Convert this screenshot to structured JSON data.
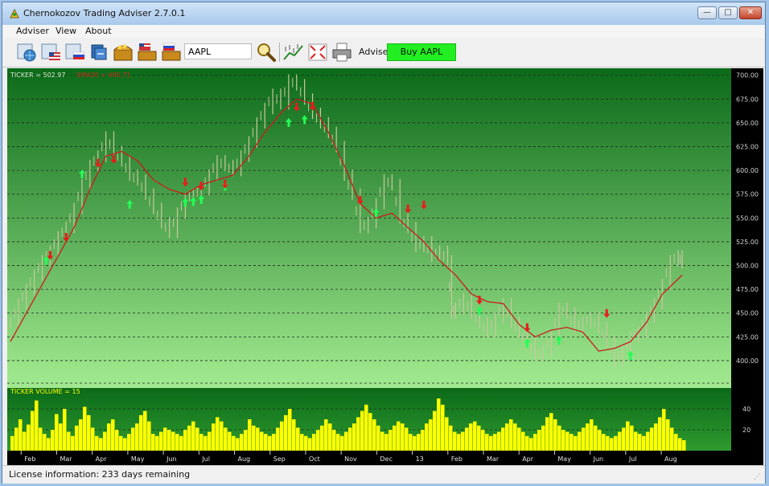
{
  "window": {
    "title": "Chernokozov Trading Adviser 2.7.0.1"
  },
  "menu": [
    "Adviser",
    "View",
    "About"
  ],
  "toolbar": {
    "icons": [
      "open-globe-icon",
      "chart-us-flag-icon",
      "chart-ru-flag-icon",
      "stack-icon",
      "treasure-chest-icon",
      "treasure-chest-us-icon",
      "treasure-chest-ru-icon"
    ],
    "ticker_value": "AAPL",
    "advise_label": "Advise:",
    "advise_value": "Buy AAPL",
    "colors": {
      "advise_bg": "#22ee22"
    }
  },
  "status": {
    "text": "License information: 233 days remaining"
  },
  "chart_data": [
    {
      "type": "line",
      "name": "price-chart",
      "legend": [
        "TICKER = 502.97",
        "SMA20 = 490.71"
      ],
      "colors": {
        "bg_top": "#0d6b1a",
        "bg_bottom": "#9ee68a",
        "price": "#c9c9a0",
        "sma": "#cc1b1b",
        "grid": "#333333"
      },
      "yticks": [
        700,
        675,
        650,
        625,
        600,
        575,
        550,
        525,
        500,
        475,
        450,
        425,
        400
      ],
      "ylim": [
        378,
        704
      ],
      "grid": true,
      "x_months": [
        "Feb",
        "Mar",
        "Apr",
        "May",
        "Jun",
        "Jul",
        "Aug",
        "Sep",
        "Oct",
        "Nov",
        "Dec",
        "13",
        "Feb",
        "Mar",
        "Apr",
        "May",
        "Jun",
        "Jul",
        "Aug"
      ],
      "price_points": [
        [
          0,
          440
        ],
        [
          2,
          460
        ],
        [
          4,
          475
        ],
        [
          6,
          490
        ],
        [
          8,
          505
        ],
        [
          10,
          515
        ],
        [
          12,
          530
        ],
        [
          14,
          540
        ],
        [
          16,
          560
        ],
        [
          18,
          585
        ],
        [
          20,
          605
        ],
        [
          22,
          615
        ],
        [
          24,
          635
        ],
        [
          26,
          620
        ],
        [
          28,
          610
        ],
        [
          30,
          595
        ],
        [
          32,
          590
        ],
        [
          34,
          575
        ],
        [
          36,
          560
        ],
        [
          38,
          545
        ],
        [
          40,
          535
        ],
        [
          42,
          555
        ],
        [
          44,
          570
        ],
        [
          46,
          575
        ],
        [
          48,
          580
        ],
        [
          50,
          595
        ],
        [
          52,
          610
        ],
        [
          54,
          605
        ],
        [
          56,
          600
        ],
        [
          58,
          615
        ],
        [
          60,
          630
        ],
        [
          62,
          650
        ],
        [
          64,
          665
        ],
        [
          66,
          680
        ],
        [
          68,
          670
        ],
        [
          70,
          695
        ],
        [
          72,
          690
        ],
        [
          74,
          675
        ],
        [
          76,
          660
        ],
        [
          78,
          650
        ],
        [
          80,
          640
        ],
        [
          82,
          625
        ],
        [
          84,
          595
        ],
        [
          86,
          575
        ],
        [
          88,
          540
        ],
        [
          90,
          545
        ],
        [
          92,
          565
        ],
        [
          94,
          590
        ],
        [
          96,
          585
        ],
        [
          98,
          550
        ],
        [
          100,
          540
        ],
        [
          102,
          520
        ],
        [
          104,
          525
        ],
        [
          106,
          510
        ],
        [
          108,
          515
        ],
        [
          110,
          505
        ],
        [
          111,
          450
        ],
        [
          112,
          455
        ],
        [
          114,
          465
        ],
        [
          116,
          450
        ],
        [
          118,
          440
        ],
        [
          120,
          430
        ],
        [
          122,
          445
        ],
        [
          124,
          460
        ],
        [
          126,
          440
        ],
        [
          128,
          430
        ],
        [
          130,
          420
        ],
        [
          132,
          405
        ],
        [
          134,
          410
        ],
        [
          136,
          425
        ],
        [
          138,
          455
        ],
        [
          140,
          450
        ],
        [
          142,
          435
        ],
        [
          144,
          440
        ],
        [
          146,
          445
        ],
        [
          148,
          435
        ],
        [
          150,
          420
        ],
        [
          152,
          400
        ],
        [
          154,
          410
        ],
        [
          156,
          425
        ],
        [
          158,
          430
        ],
        [
          160,
          445
        ],
        [
          162,
          460
        ],
        [
          164,
          480
        ],
        [
          166,
          505
        ],
        [
          168,
          510
        ],
        [
          169,
          503
        ]
      ],
      "sma_points": [
        [
          0,
          420
        ],
        [
          4,
          450
        ],
        [
          8,
          480
        ],
        [
          12,
          510
        ],
        [
          16,
          540
        ],
        [
          20,
          580
        ],
        [
          24,
          615
        ],
        [
          28,
          620
        ],
        [
          32,
          610
        ],
        [
          36,
          590
        ],
        [
          40,
          580
        ],
        [
          44,
          575
        ],
        [
          48,
          585
        ],
        [
          52,
          590
        ],
        [
          56,
          595
        ],
        [
          60,
          615
        ],
        [
          64,
          640
        ],
        [
          68,
          660
        ],
        [
          72,
          675
        ],
        [
          76,
          670
        ],
        [
          80,
          640
        ],
        [
          84,
          605
        ],
        [
          88,
          565
        ],
        [
          92,
          550
        ],
        [
          96,
          555
        ],
        [
          100,
          540
        ],
        [
          104,
          525
        ],
        [
          108,
          505
        ],
        [
          112,
          490
        ],
        [
          116,
          470
        ],
        [
          120,
          462
        ],
        [
          124,
          460
        ],
        [
          128,
          438
        ],
        [
          132,
          425
        ],
        [
          136,
          432
        ],
        [
          140,
          435
        ],
        [
          144,
          430
        ],
        [
          148,
          410
        ],
        [
          152,
          413
        ],
        [
          156,
          420
        ],
        [
          160,
          440
        ],
        [
          164,
          470
        ],
        [
          169,
          490
        ]
      ],
      "buy_signals": [
        [
          9,
          505
        ],
        [
          18,
          596
        ],
        [
          30,
          564
        ],
        [
          44,
          566
        ],
        [
          46,
          567
        ],
        [
          48,
          569
        ],
        [
          54,
          583
        ],
        [
          70,
          650
        ],
        [
          74,
          653
        ],
        [
          92,
          555
        ],
        [
          118,
          452
        ],
        [
          130,
          418
        ],
        [
          138,
          421
        ],
        [
          156,
          405
        ]
      ],
      "sell_signals": [
        [
          10,
          511
        ],
        [
          14,
          530
        ],
        [
          22,
          608
        ],
        [
          26,
          612
        ],
        [
          44,
          588
        ],
        [
          48,
          584
        ],
        [
          54,
          586
        ],
        [
          72,
          667
        ],
        [
          76,
          668
        ],
        [
          88,
          569
        ],
        [
          100,
          560
        ],
        [
          104,
          564
        ],
        [
          118,
          464
        ],
        [
          130,
          435
        ],
        [
          150,
          450
        ]
      ]
    },
    {
      "type": "bar",
      "name": "volume-chart",
      "legend": [
        "TICKER VOLUME = 15"
      ],
      "colors": {
        "bar": "#ffff00",
        "bg_top": "#0d6b1a",
        "bg_bottom": "#9ee68a"
      },
      "yticks": [
        40,
        20
      ],
      "ylim": [
        0,
        60
      ],
      "values": [
        14,
        22,
        30,
        18,
        25,
        38,
        48,
        22,
        16,
        12,
        20,
        35,
        26,
        40,
        18,
        14,
        24,
        30,
        42,
        34,
        22,
        14,
        12,
        18,
        26,
        30,
        20,
        14,
        12,
        16,
        22,
        26,
        34,
        38,
        28,
        16,
        14,
        18,
        22,
        20,
        18,
        16,
        14,
        20,
        24,
        28,
        22,
        16,
        14,
        18,
        26,
        32,
        28,
        22,
        18,
        14,
        12,
        16,
        20,
        30,
        24,
        22,
        18,
        16,
        14,
        16,
        22,
        28,
        34,
        40,
        30,
        22,
        16,
        14,
        12,
        16,
        20,
        24,
        30,
        26,
        20,
        16,
        14,
        18,
        22,
        26,
        32,
        38,
        44,
        36,
        30,
        24,
        18,
        16,
        20,
        24,
        28,
        26,
        22,
        16,
        14,
        16,
        20,
        26,
        30,
        38,
        50,
        44,
        32,
        24,
        18,
        16,
        18,
        22,
        26,
        28,
        24,
        20,
        16,
        14,
        16,
        18,
        22,
        26,
        30,
        26,
        22,
        18,
        14,
        12,
        16,
        20,
        24,
        32,
        36,
        30,
        24,
        20,
        18,
        16,
        14,
        18,
        22,
        26,
        30,
        24,
        20,
        16,
        14,
        12,
        14,
        18,
        22,
        28,
        24,
        18,
        16,
        14,
        18,
        22,
        26,
        32,
        40,
        30,
        22,
        16,
        12,
        10
      ]
    }
  ]
}
